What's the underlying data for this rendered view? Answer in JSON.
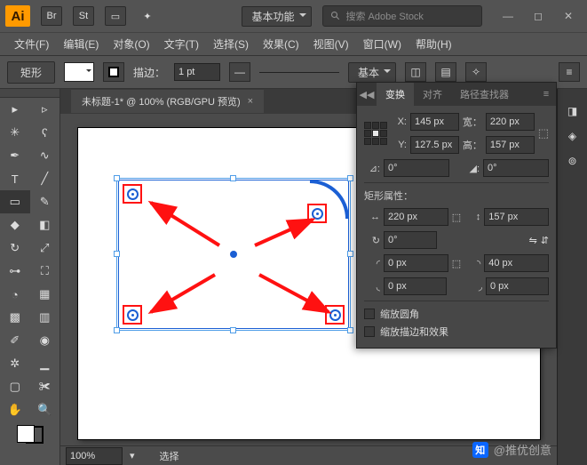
{
  "top": {
    "workspace": "基本功能",
    "search_ph": "搜索 Adobe Stock"
  },
  "menu": {
    "file": "文件(F)",
    "edit": "编辑(E)",
    "object": "对象(O)",
    "type": "文字(T)",
    "select": "选择(S)",
    "effect": "效果(C)",
    "view": "视图(V)",
    "window": "窗口(W)",
    "help": "帮助(H)"
  },
  "opt": {
    "shape": "矩形",
    "stroke_lbl": "描边：",
    "stroke_w": "1 pt",
    "style": "基本"
  },
  "doc": {
    "tab": "未标题-1* @ 100% (RGB/GPU 预览)"
  },
  "status": {
    "zoom": "100%",
    "sel": "选择"
  },
  "panel": {
    "dock": "◀◀",
    "tab_transform": "变换",
    "tab_align": "对齐",
    "tab_pathfinder": "路径查找器",
    "x_lbl": "X:",
    "x": "145 px",
    "w_lbl": "宽：",
    "w": "220 px",
    "y_lbl": "Y:",
    "y": "127.5 px",
    "h_lbl": "高：",
    "h": "157 px",
    "ang_lbl": "⊿:",
    "ang": "0°",
    "shear_lbl": "◢:",
    "shear": "0°",
    "sect": "矩形属性：",
    "rw": "220 px",
    "rh": "157 px",
    "rot": "0°",
    "c_tl": "0 px",
    "c_tr": "40 px",
    "c_bl": "0 px",
    "c_br": "0 px",
    "scale_corners": "缩放圆角",
    "scale_strokes": "缩放描边和效果"
  },
  "water": {
    "text": "@推优创意"
  }
}
